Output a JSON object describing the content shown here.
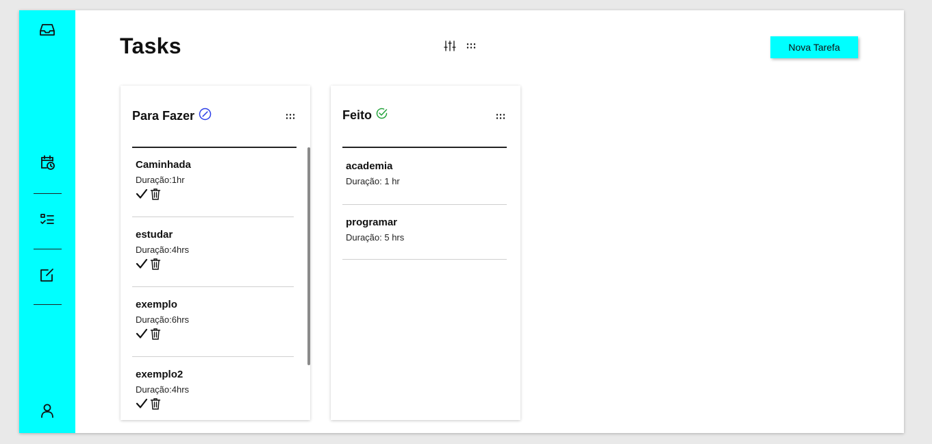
{
  "colors": {
    "accent": "#00ffff",
    "todo_icon": "#2a3de8",
    "done_icon": "#23a23a"
  },
  "header": {
    "title": "Tasks",
    "new_task_label": "Nova Tarefa",
    "icons": [
      "sliders-icon",
      "grid-dots-icon"
    ]
  },
  "sidebar": {
    "icons": [
      "inbox-icon",
      "calendar-clock-icon",
      "checklist-icon",
      "edit-icon",
      "user-icon"
    ]
  },
  "columns": [
    {
      "title": "Para Fazer",
      "status_icon": "circle-slash-icon",
      "tasks": [
        {
          "name": "Caminhada",
          "duration": "Duração:1hr"
        },
        {
          "name": "estudar",
          "duration": "Duração:4hrs"
        },
        {
          "name": "exemplo",
          "duration": "Duração:6hrs"
        },
        {
          "name": "exemplo2",
          "duration": "Duração:4hrs"
        }
      ]
    },
    {
      "title": "Feito",
      "status_icon": "circle-check-icon",
      "tasks": [
        {
          "name": "academia",
          "duration": "Duração: 1 hr"
        },
        {
          "name": "programar",
          "duration": "Duração: 5 hrs"
        }
      ]
    }
  ]
}
